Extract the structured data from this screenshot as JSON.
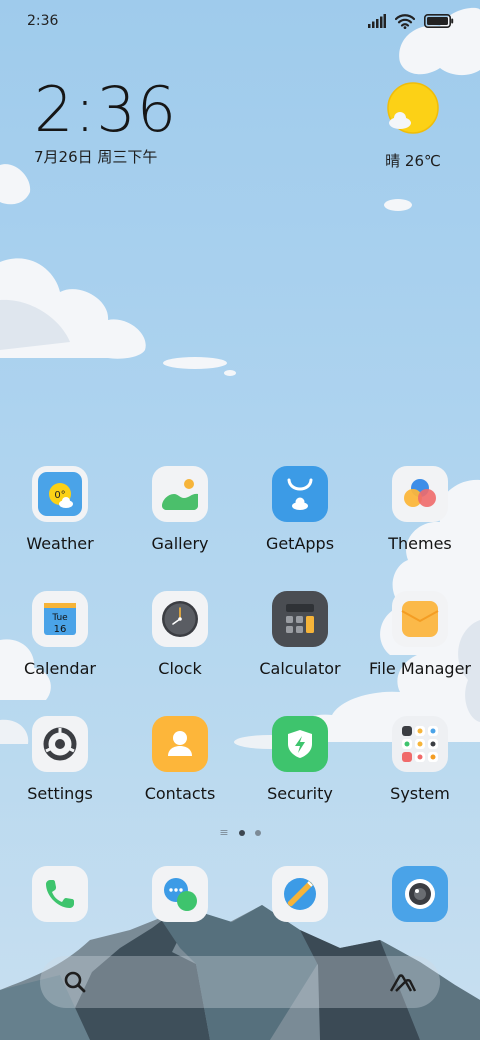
{
  "status_bar": {
    "time": "2:36"
  },
  "clock_widget": {
    "time": "2:36",
    "date": "7月26日 周三下午"
  },
  "weather_widget": {
    "text": "晴 26℃",
    "icon": "sun-cloud-icon"
  },
  "apps": [
    [
      {
        "label": "Weather",
        "icon": "weather-icon"
      },
      {
        "label": "Gallery",
        "icon": "gallery-icon"
      },
      {
        "label": "GetApps",
        "icon": "getapps-icon"
      },
      {
        "label": "Themes",
        "icon": "themes-icon"
      }
    ],
    [
      {
        "label": "Calendar",
        "icon": "calendar-icon"
      },
      {
        "label": "Clock",
        "icon": "clock-icon"
      },
      {
        "label": "Calculator",
        "icon": "calculator-icon"
      },
      {
        "label": "File Manager",
        "icon": "file-manager-icon"
      }
    ],
    [
      {
        "label": "Settings",
        "icon": "settings-icon"
      },
      {
        "label": "Contacts",
        "icon": "contacts-icon"
      },
      {
        "label": "Security",
        "icon": "security-icon"
      },
      {
        "label": "System",
        "icon": "folder-icon"
      }
    ]
  ],
  "icon_text": {
    "weather_temp": "0°",
    "calendar_day": "Tue",
    "calendar_date": "16"
  },
  "dock": [
    {
      "icon": "phone-icon"
    },
    {
      "icon": "messaging-icon"
    },
    {
      "icon": "browser-icon"
    },
    {
      "icon": "camera-icon"
    }
  ],
  "pages": {
    "count": 2,
    "current": 1
  },
  "colors": {
    "sky": "#a9d0ee",
    "weather_blue": "#4aa3e8",
    "getapps_blue": "#3c9be6",
    "contacts_orange": "#fdb63a",
    "security_green": "#3ec46d",
    "calculator_dark": "#4a4d52",
    "file_orange": "#fbb949"
  }
}
